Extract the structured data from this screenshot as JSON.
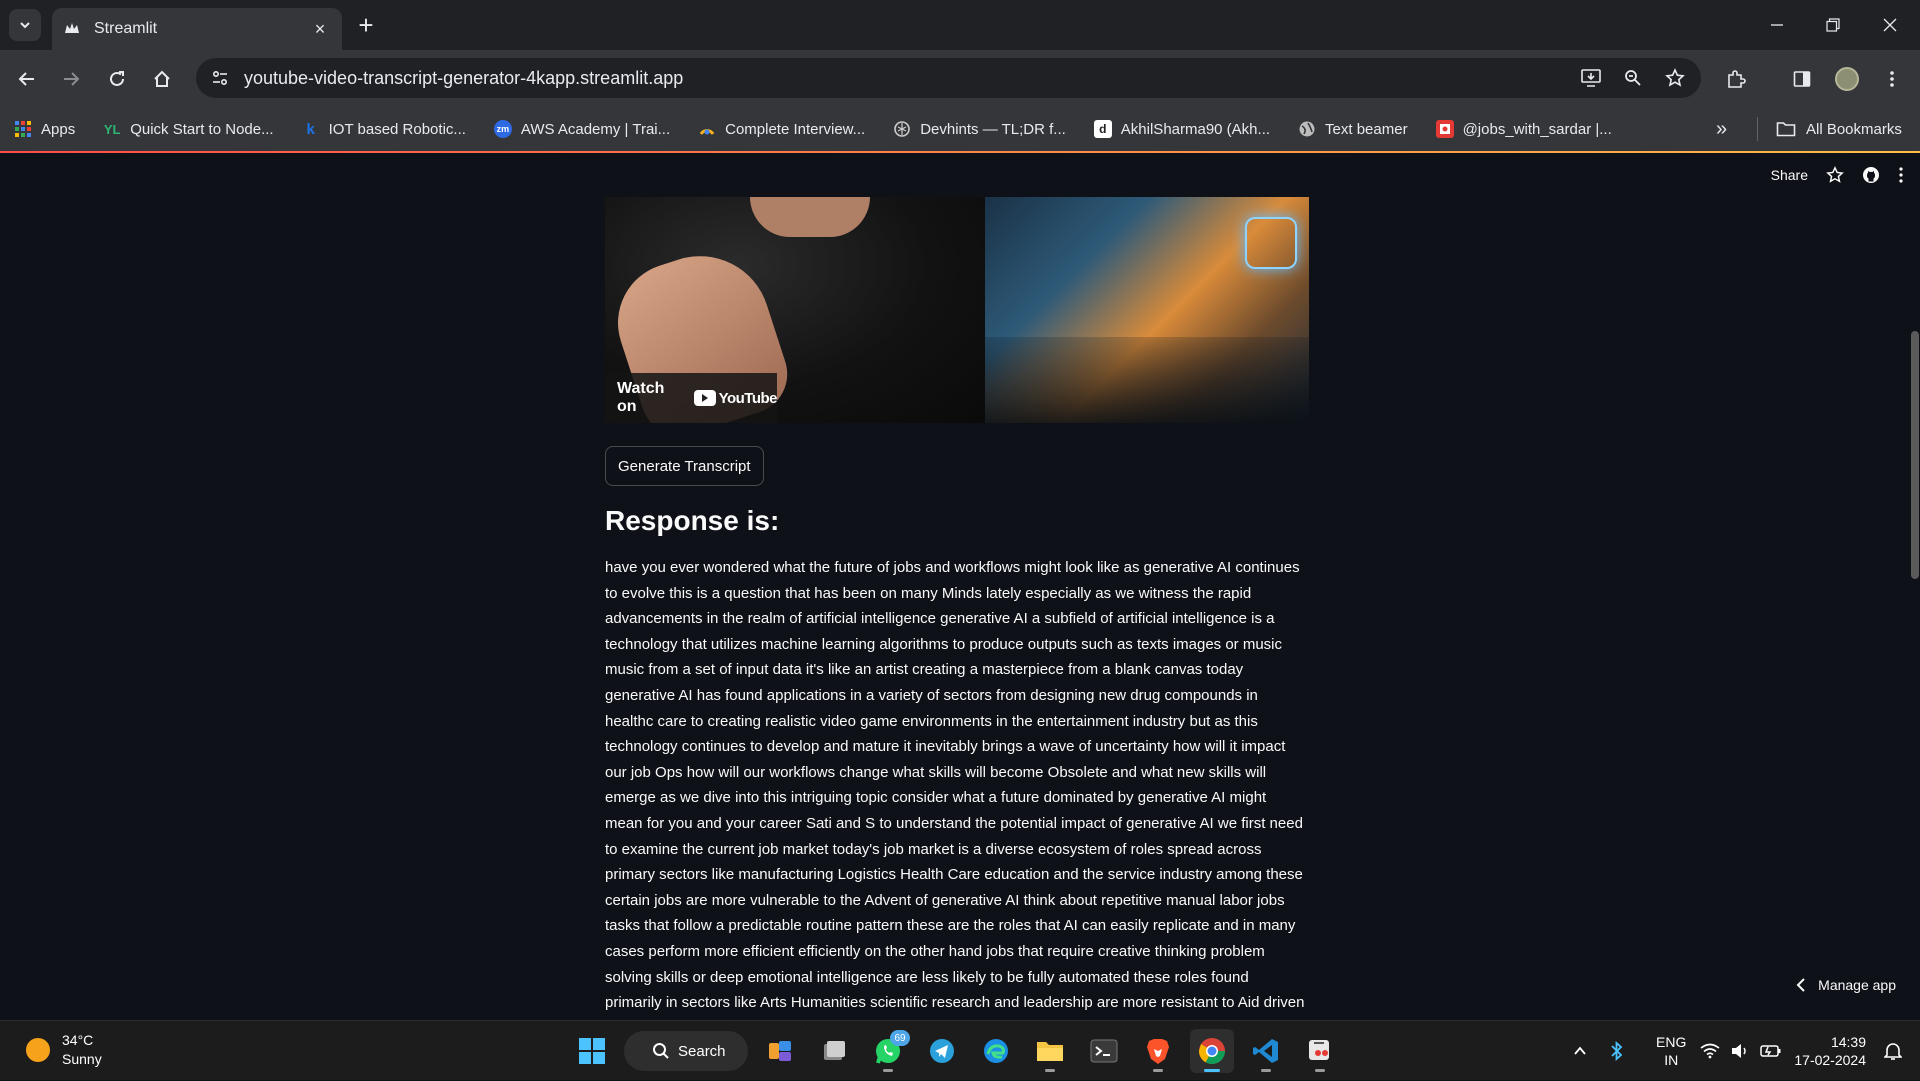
{
  "browser": {
    "tab_title": "Streamlit",
    "url": "youtube-video-transcript-generator-4kapp.streamlit.app",
    "bookmarks": [
      {
        "label": "Apps",
        "icon": "apps-grid-icon",
        "color": "#4285f4"
      },
      {
        "label": "Quick Start to Node...",
        "icon": "yl-icon",
        "color": "#2bb673"
      },
      {
        "label": "IOT based Robotic...",
        "icon": "k-icon",
        "color": "#1a73e8"
      },
      {
        "label": "AWS Academy | Trai...",
        "icon": "zm-icon",
        "color": "#2d6ae3"
      },
      {
        "label": "Complete Interview...",
        "icon": "interview-icon",
        "color": "#f6b01b"
      },
      {
        "label": "Devhints — TL;DR f...",
        "icon": "openai-icon",
        "color": "#cccccc"
      },
      {
        "label": "AkhilSharma90 (Akh...",
        "icon": "github-square-icon",
        "color": "#ffffff"
      },
      {
        "label": "Text beamer",
        "icon": "globe-icon",
        "color": "#cccccc"
      },
      {
        "label": "@jobs_with_sardar |...",
        "icon": "jobs-icon",
        "color": "#e53935"
      }
    ],
    "all_bookmarks_label": "All Bookmarks"
  },
  "app_header": {
    "share_label": "Share"
  },
  "video": {
    "watch_on_label": "Watch on",
    "youtube_label": "YouTube"
  },
  "main": {
    "button_label": "Generate Transcript",
    "response_heading": "Response is:",
    "transcript_lines": [
      "have you ever wondered what the future of jobs and workflows might look like as generative AI continues",
      "to evolve this is a question that has been on many Minds lately especially as we witness the rapid",
      "advancements in the realm of artificial intelligence generative AI a subfield of artificial intelligence is a",
      "technology that utilizes machine learning algorithms to produce outputs such as texts images or music",
      "music from a set of input data it's like an artist creating a masterpiece from a blank canvas today",
      "generative AI has found applications in a variety of sectors from designing new drug compounds in",
      "healthc care to creating realistic video game environments in the entertainment industry but as this",
      "technology continues to develop and mature it inevitably brings a wave of uncertainty how will it impact",
      "our job Ops how will our workflows change what skills will become Obsolete and what new skills will",
      "emerge as we dive into this intriguing topic consider what a future dominated by generative AI might",
      "mean for you and your career Sati and S to understand the potential impact of generative AI we first need",
      "to examine the current job market today's job market is a diverse ecosystem of roles spread across",
      "primary sectors like manufacturing Logistics Health Care education and the service industry among these",
      "certain jobs are more vulnerable to the Advent of generative AI think about repetitive manual labor jobs",
      "tasks that follow a predictable routine pattern these are the roles that AI can easily replicate and in many",
      "cases perform more efficient efficiently on the other hand jobs that require creative thinking problem",
      "solving skills or deep emotional intelligence are less likely to be fully automated these roles found",
      "primarily in sectors like Arts Humanities scientific research and leadership are more resistant to Aid driven"
    ]
  },
  "manage_app_label": "Manage app",
  "taskbar": {
    "temperature": "34°C",
    "condition": "Sunny",
    "search_label": "Search",
    "whatsapp_badge": "69",
    "lang_top": "ENG",
    "lang_bottom": "IN",
    "time": "14:39",
    "date": "17-02-2024"
  }
}
